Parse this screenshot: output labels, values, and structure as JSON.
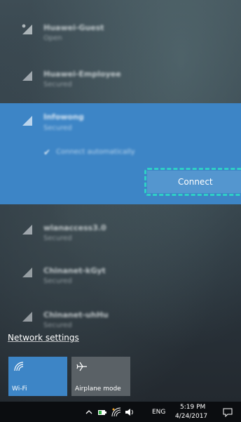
{
  "networks": [
    {
      "name": "Huawei-Guest",
      "status": "Open"
    },
    {
      "name": "Huawei-Employee",
      "status": "Secured"
    },
    {
      "name": "Infowong",
      "status": "Secured"
    },
    {
      "name": "wlanaccess3.0",
      "status": "Secured"
    },
    {
      "name": "Chinanet-kGyt",
      "status": "Secured"
    },
    {
      "name": "Chinanet-uhHu",
      "status": "Secured"
    }
  ],
  "selected": {
    "connect_automatically": "Connect automatically",
    "connect_label": "Connect"
  },
  "network_settings": "Network settings",
  "quick_actions": {
    "wifi_label": "Wi-Fi",
    "airplane_label": "Airplane mode"
  },
  "taskbar": {
    "language": "ENG",
    "time": "5:19 PM",
    "date": "4/24/2017"
  },
  "colors": {
    "accent": "#3d85c6",
    "highlight": "#2fd0c6"
  }
}
